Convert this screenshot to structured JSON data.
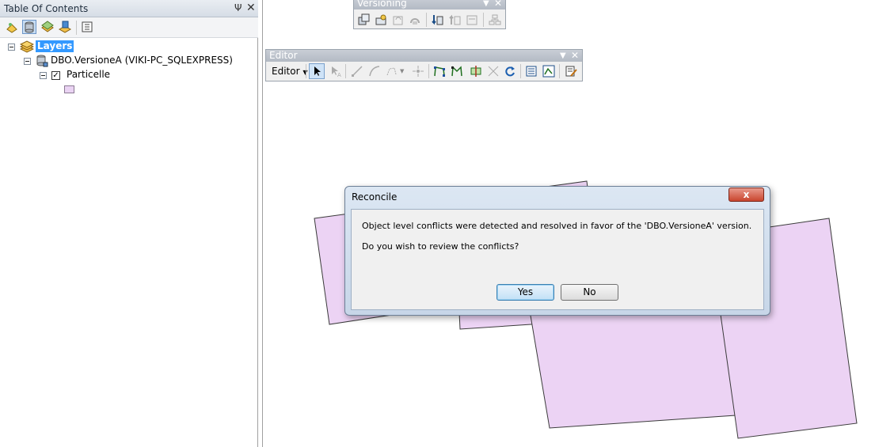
{
  "toc": {
    "title": "Table Of Contents",
    "pin_glyph": "Ψ",
    "close_glyph": "✕",
    "toolbar_icons": [
      "list-by-drawing-order-icon",
      "list-by-source-icon",
      "list-by-visibility-icon",
      "list-by-selection-icon",
      "options-icon"
    ],
    "layers_label": "Layers",
    "connection_label": "DBO.VersioneA (VIKI-PC_SQLEXPRESS)",
    "layer_label": "Particelle",
    "layer_checked": true,
    "symbol_color": "#ead3f3"
  },
  "versioning_toolbar": {
    "title": "Versioning",
    "icons": [
      "version-manager-icon",
      "create-version-icon",
      "refresh-icon",
      "change-version-icon",
      "reconcile-icon",
      "post-icon",
      "version-changes-icon",
      "conflicts-icon"
    ]
  },
  "editor_toolbar": {
    "title": "Editor",
    "menu_label": "Editor",
    "icons": [
      "edit-tool-icon",
      "annotation-edit-icon",
      "straight-segment-icon",
      "endpoint-arc-icon",
      "trace-icon",
      "point-icon",
      "edit-vertices-icon",
      "reshape-feature-icon",
      "cut-polygons-icon",
      "split-tool-icon",
      "rotate-tool-icon",
      "attributes-icon",
      "sketch-properties-icon",
      "create-features-icon"
    ]
  },
  "dialog": {
    "title": "Reconcile",
    "message": "Object level conflicts were detected and resolved in favor of the 'DBO.VersioneA' version.",
    "question": "Do you wish to review the conflicts?",
    "yes_label": "Yes",
    "no_label": "No",
    "close_glyph": "x"
  },
  "colors": {
    "polygon_fill": "#ecd3f4",
    "polygon_stroke": "#3b3b3b",
    "selection_highlight": "#3399ff"
  }
}
